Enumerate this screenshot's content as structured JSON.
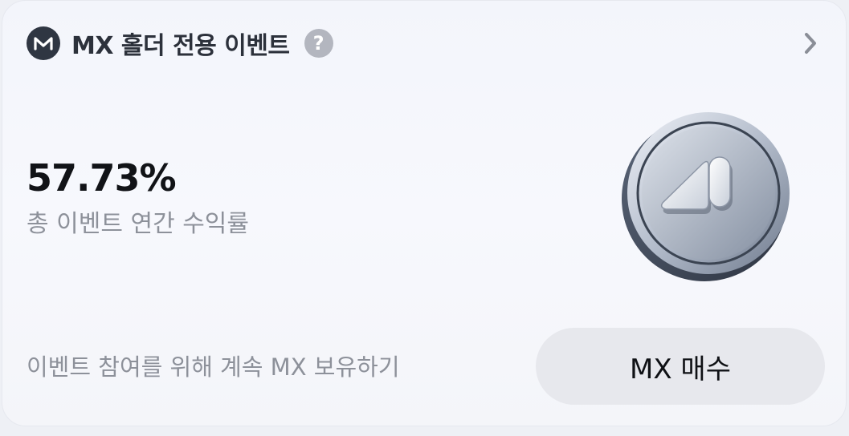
{
  "header": {
    "title": "MX 홀더 전용 이벤트",
    "help_glyph": "?",
    "logo_icon": "mx-logo-icon",
    "chevron_icon": "chevron-right-icon"
  },
  "stats": {
    "rate": "57.73%",
    "rate_label": "총 이벤트 연간 수익률"
  },
  "footer": {
    "note": "이벤트 참여를 위해 계속 MX 보유하기",
    "buy_label": "MX 매수"
  },
  "colors": {
    "card_bg": "#f5f6fb",
    "logo_bg": "#2f3642",
    "button_bg": "#e7e8ed",
    "muted_text": "#8d919a"
  }
}
